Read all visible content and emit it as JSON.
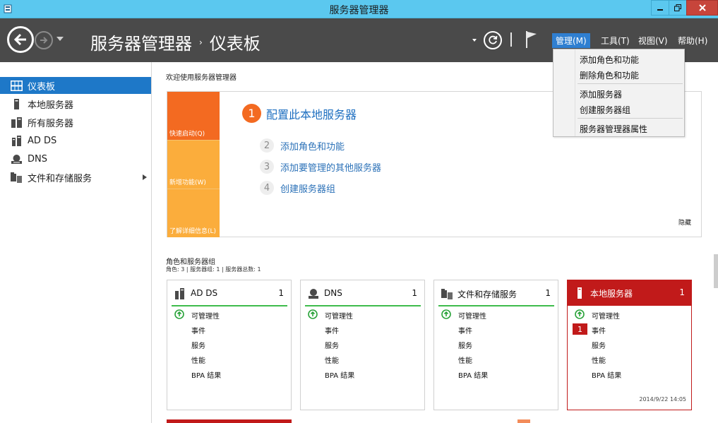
{
  "window": {
    "title": "服务器管理器",
    "app_icon": "server-manager-icon"
  },
  "header": {
    "breadcrumb_root": "服务器管理器",
    "breadcrumb_separator": "›",
    "breadcrumb_current": "仪表板",
    "menus": {
      "manage": "管理(M)",
      "tools": "工具(T)",
      "view": "视图(V)",
      "help": "帮助(H)"
    }
  },
  "manage_menu": {
    "items": [
      "添加角色和功能",
      "删除角色和功能",
      "添加服务器",
      "创建服务器组",
      "服务器管理器属性"
    ]
  },
  "sidebar": {
    "items": [
      {
        "label": "仪表板",
        "icon": "dashboard-icon",
        "active": true
      },
      {
        "label": "本地服务器",
        "icon": "server-icon"
      },
      {
        "label": "所有服务器",
        "icon": "servers-icon"
      },
      {
        "label": "AD DS",
        "icon": "ad-ds-icon"
      },
      {
        "label": "DNS",
        "icon": "dns-icon"
      },
      {
        "label": "文件和存储服务",
        "icon": "file-storage-icon"
      }
    ]
  },
  "welcome": {
    "title": "欢迎使用服务器管理器",
    "tiles": [
      "快速启动(Q)",
      "新增功能(W)",
      "了解详细信息(L)"
    ],
    "main_step": {
      "num": "1",
      "label": "配置此本地服务器"
    },
    "steps": [
      {
        "num": "2",
        "label": "添加角色和功能"
      },
      {
        "num": "3",
        "label": "添加要管理的其他服务器"
      },
      {
        "num": "4",
        "label": "创建服务器组"
      }
    ],
    "hide": "隐藏"
  },
  "roles": {
    "title": "角色和服务器组",
    "summary": "角色: 3 | 服务器组: 1 | 服务器总数: 1",
    "row_labels": [
      "可管理性",
      "事件",
      "服务",
      "性能",
      "BPA 结果"
    ],
    "cards": [
      {
        "name": "AD DS",
        "count": "1",
        "icon": "ad-ds-icon"
      },
      {
        "name": "DNS",
        "count": "1",
        "icon": "dns-icon"
      },
      {
        "name": "文件和存储服务",
        "count": "1",
        "icon": "file-storage-icon"
      },
      {
        "name": "本地服务器",
        "count": "1",
        "icon": "server-icon",
        "alert": true,
        "event_badge": "1",
        "timestamp": "2014/9/22 14:05"
      }
    ]
  },
  "colors": {
    "accent_blue": "#1e78c8",
    "quick_start_orange": "#f36a21",
    "tile_amber": "#fbad3c",
    "alert_red": "#c11a1a",
    "ok_green": "#3fbc4c"
  }
}
